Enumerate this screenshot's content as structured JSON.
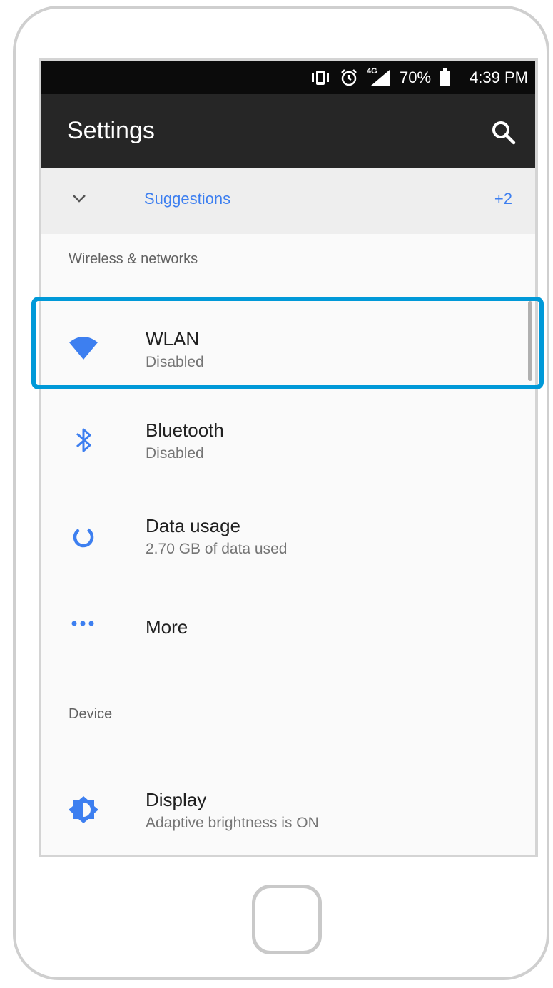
{
  "status_bar": {
    "icons": [
      "vibrate-icon",
      "alarm-icon",
      "signal-4g-icon",
      "battery-icon"
    ],
    "network_label": "4G",
    "battery": "70%",
    "time": "4:39 PM"
  },
  "app_bar": {
    "title": "Settings",
    "search_icon": "search-icon"
  },
  "suggestions": {
    "label": "Suggestions",
    "count": "+2",
    "icon": "chevron-down-icon"
  },
  "sections": [
    {
      "header": "Wireless & networks",
      "items": [
        {
          "title": "WLAN",
          "subtitle": "Disabled",
          "icon": "wifi-icon",
          "highlighted": true
        },
        {
          "title": "Bluetooth",
          "subtitle": "Disabled",
          "icon": "bluetooth-icon"
        },
        {
          "title": "Data usage",
          "subtitle": "2.70 GB of data used",
          "icon": "data-usage-icon"
        },
        {
          "title": "More",
          "subtitle": "",
          "icon": "more-icon"
        }
      ]
    },
    {
      "header": "Device",
      "items": [
        {
          "title": "Display",
          "subtitle": "Adaptive brightness is ON",
          "icon": "brightness-icon"
        }
      ]
    }
  ],
  "colors": {
    "accent": "#3d7ff0",
    "highlight_border": "#0099d8",
    "app_bar": "#262626",
    "status_bar": "#0b0b0b"
  }
}
